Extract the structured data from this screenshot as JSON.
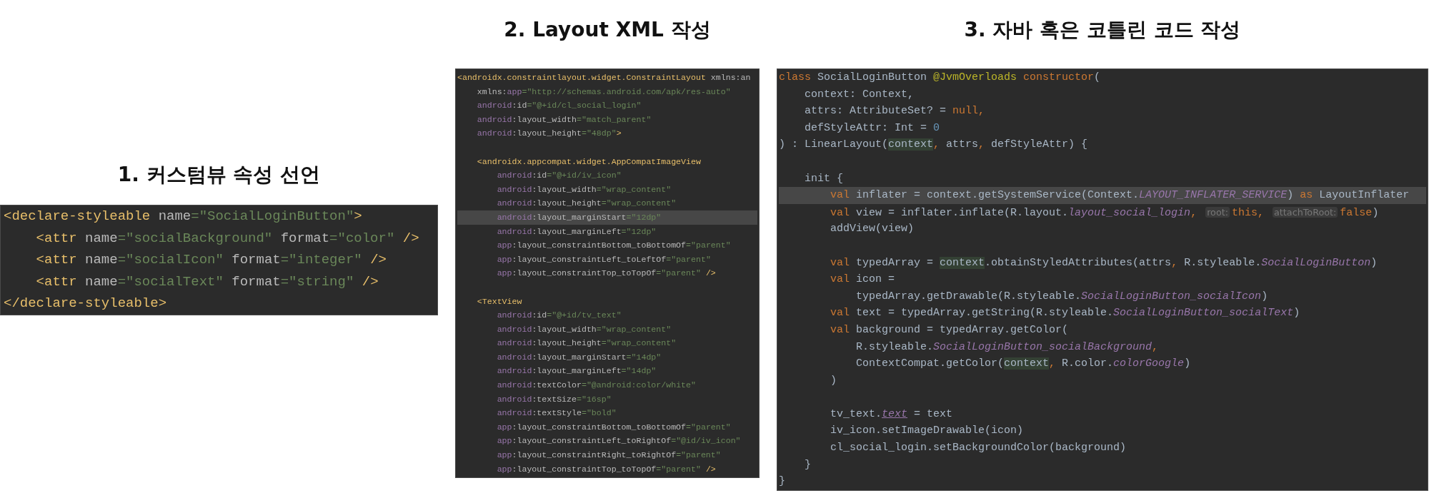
{
  "panels": [
    {
      "title": "1. 커스텀뷰 속성 선언",
      "lines": [
        {
          "kind": "code",
          "current": false,
          "tokens": [
            {
              "text": "<declare-styleable",
              "kind": "tag"
            },
            {
              "text": " name",
              "kind": "attr"
            },
            {
              "text": "=\"SocialLoginButton\"",
              "kind": "str"
            },
            {
              "text": ">",
              "kind": "tag"
            }
          ]
        },
        {
          "kind": "code",
          "current": false,
          "tokens": [
            {
              "text": "    <attr",
              "kind": "tag"
            },
            {
              "text": " name",
              "kind": "attr"
            },
            {
              "text": "=\"socialBackground\"",
              "kind": "str"
            },
            {
              "text": " format",
              "kind": "attr"
            },
            {
              "text": "=\"color\"",
              "kind": "str"
            },
            {
              "text": " />",
              "kind": "tag"
            }
          ]
        },
        {
          "kind": "code",
          "current": false,
          "tokens": [
            {
              "text": "    <attr",
              "kind": "tag"
            },
            {
              "text": " name",
              "kind": "attr"
            },
            {
              "text": "=\"socialIcon\"",
              "kind": "str"
            },
            {
              "text": " format",
              "kind": "attr"
            },
            {
              "text": "=\"integer\"",
              "kind": "str"
            },
            {
              "text": " />",
              "kind": "tag"
            }
          ]
        },
        {
          "kind": "code",
          "current": false,
          "tokens": [
            {
              "text": "    <attr",
              "kind": "tag"
            },
            {
              "text": " name",
              "kind": "attr"
            },
            {
              "text": "=\"socialText\"",
              "kind": "str"
            },
            {
              "text": " format",
              "kind": "attr"
            },
            {
              "text": "=\"string\"",
              "kind": "str"
            },
            {
              "text": " />",
              "kind": "tag"
            }
          ]
        },
        {
          "kind": "code",
          "current": false,
          "tokens": [
            {
              "text": "</declare-styleable>",
              "kind": "tag"
            }
          ]
        }
      ]
    },
    {
      "title": "2. Layout XML 작성",
      "lines": [
        {
          "kind": "code",
          "current": false,
          "tokens": [
            {
              "text": "<androidx.constraintlayout.widget.ConstraintLayout",
              "kind": "tag"
            },
            {
              "text": " xmlns:an",
              "kind": "attr"
            }
          ]
        },
        {
          "kind": "code",
          "current": false,
          "tokens": [
            {
              "text": "    xmlns:",
              "kind": "attr"
            },
            {
              "text": "app",
              "kind": "ns"
            },
            {
              "text": "=\"http://schemas.android.com/apk/res-auto\"",
              "kind": "str"
            }
          ]
        },
        {
          "kind": "code",
          "current": false,
          "tokens": [
            {
              "text": "    android",
              "kind": "ns"
            },
            {
              "text": ":id",
              "kind": "attr"
            },
            {
              "text": "=\"@+id/cl_social_login\"",
              "kind": "str"
            }
          ]
        },
        {
          "kind": "code",
          "current": false,
          "tokens": [
            {
              "text": "    android",
              "kind": "ns"
            },
            {
              "text": ":layout_width",
              "kind": "attr"
            },
            {
              "text": "=\"match_parent\"",
              "kind": "str"
            }
          ]
        },
        {
          "kind": "code",
          "current": false,
          "tokens": [
            {
              "text": "    android",
              "kind": "ns"
            },
            {
              "text": ":layout_height",
              "kind": "attr"
            },
            {
              "text": "=\"48dp\"",
              "kind": "str"
            },
            {
              "text": ">",
              "kind": "tag"
            }
          ]
        },
        {
          "kind": "blank",
          "current": false
        },
        {
          "kind": "code",
          "current": false,
          "tokens": [
            {
              "text": "    <androidx.appcompat.widget.AppCompatImageView",
              "kind": "tag"
            }
          ]
        },
        {
          "kind": "code",
          "current": false,
          "tokens": [
            {
              "text": "        android",
              "kind": "ns"
            },
            {
              "text": ":id",
              "kind": "attr"
            },
            {
              "text": "=\"@+id/iv_icon\"",
              "kind": "str"
            }
          ]
        },
        {
          "kind": "code",
          "current": false,
          "tokens": [
            {
              "text": "        android",
              "kind": "ns"
            },
            {
              "text": ":layout_width",
              "kind": "attr"
            },
            {
              "text": "=\"wrap_content\"",
              "kind": "str"
            }
          ]
        },
        {
          "kind": "code",
          "current": false,
          "tokens": [
            {
              "text": "        android",
              "kind": "ns"
            },
            {
              "text": ":layout_height",
              "kind": "attr"
            },
            {
              "text": "=\"wrap_content\"",
              "kind": "str"
            }
          ]
        },
        {
          "kind": "code",
          "current": true,
          "tokens": [
            {
              "text": "        android",
              "kind": "ns"
            },
            {
              "text": ":layout_marginStart",
              "kind": "attr"
            },
            {
              "text": "=\"12dp\"",
              "kind": "str"
            }
          ]
        },
        {
          "kind": "code",
          "current": false,
          "tokens": [
            {
              "text": "        android",
              "kind": "ns"
            },
            {
              "text": ":layout_marginLeft",
              "kind": "attr"
            },
            {
              "text": "=\"12dp\"",
              "kind": "str"
            }
          ]
        },
        {
          "kind": "code",
          "current": false,
          "tokens": [
            {
              "text": "        app",
              "kind": "ns"
            },
            {
              "text": ":layout_constraintBottom_toBottomOf",
              "kind": "attr"
            },
            {
              "text": "=\"parent\"",
              "kind": "str"
            }
          ]
        },
        {
          "kind": "code",
          "current": false,
          "tokens": [
            {
              "text": "        app",
              "kind": "ns"
            },
            {
              "text": ":layout_constraintLeft_toLeftOf",
              "kind": "attr"
            },
            {
              "text": "=\"parent\"",
              "kind": "str"
            }
          ]
        },
        {
          "kind": "code",
          "current": false,
          "tokens": [
            {
              "text": "        app",
              "kind": "ns"
            },
            {
              "text": ":layout_constraintTop_toTopOf",
              "kind": "attr"
            },
            {
              "text": "=\"parent\"",
              "kind": "str"
            },
            {
              "text": " />",
              "kind": "tag"
            }
          ]
        },
        {
          "kind": "blank",
          "current": false
        },
        {
          "kind": "code",
          "current": false,
          "tokens": [
            {
              "text": "    <TextView",
              "kind": "tag"
            }
          ]
        },
        {
          "kind": "code",
          "current": false,
          "tokens": [
            {
              "text": "        android",
              "kind": "ns"
            },
            {
              "text": ":id",
              "kind": "attr"
            },
            {
              "text": "=\"@+id/tv_text\"",
              "kind": "str"
            }
          ]
        },
        {
          "kind": "code",
          "current": false,
          "tokens": [
            {
              "text": "        android",
              "kind": "ns"
            },
            {
              "text": ":layout_width",
              "kind": "attr"
            },
            {
              "text": "=\"wrap_content\"",
              "kind": "str"
            }
          ]
        },
        {
          "kind": "code",
          "current": false,
          "tokens": [
            {
              "text": "        android",
              "kind": "ns"
            },
            {
              "text": ":layout_height",
              "kind": "attr"
            },
            {
              "text": "=\"wrap_content\"",
              "kind": "str"
            }
          ]
        },
        {
          "kind": "code",
          "current": false,
          "tokens": [
            {
              "text": "        android",
              "kind": "ns"
            },
            {
              "text": ":layout_marginStart",
              "kind": "attr"
            },
            {
              "text": "=\"14dp\"",
              "kind": "str"
            }
          ]
        },
        {
          "kind": "code",
          "current": false,
          "tokens": [
            {
              "text": "        android",
              "kind": "ns"
            },
            {
              "text": ":layout_marginLeft",
              "kind": "attr"
            },
            {
              "text": "=\"14dp\"",
              "kind": "str"
            }
          ]
        },
        {
          "kind": "code",
          "current": false,
          "tokens": [
            {
              "text": "        android",
              "kind": "ns"
            },
            {
              "text": ":textColor",
              "kind": "attr"
            },
            {
              "text": "=\"@android:color/white\"",
              "kind": "str"
            }
          ]
        },
        {
          "kind": "code",
          "current": false,
          "tokens": [
            {
              "text": "        android",
              "kind": "ns"
            },
            {
              "text": ":textSize",
              "kind": "attr"
            },
            {
              "text": "=\"16sp\"",
              "kind": "str"
            }
          ]
        },
        {
          "kind": "code",
          "current": false,
          "tokens": [
            {
              "text": "        android",
              "kind": "ns"
            },
            {
              "text": ":textStyle",
              "kind": "attr"
            },
            {
              "text": "=\"bold\"",
              "kind": "str"
            }
          ]
        },
        {
          "kind": "code",
          "current": false,
          "tokens": [
            {
              "text": "        app",
              "kind": "ns"
            },
            {
              "text": ":layout_constraintBottom_toBottomOf",
              "kind": "attr"
            },
            {
              "text": "=\"parent\"",
              "kind": "str"
            }
          ]
        },
        {
          "kind": "code",
          "current": false,
          "tokens": [
            {
              "text": "        app",
              "kind": "ns"
            },
            {
              "text": ":layout_constraintLeft_toRightOf",
              "kind": "attr"
            },
            {
              "text": "=\"@id/iv_icon\"",
              "kind": "str"
            }
          ]
        },
        {
          "kind": "code",
          "current": false,
          "tokens": [
            {
              "text": "        app",
              "kind": "ns"
            },
            {
              "text": ":layout_constraintRight_toRightOf",
              "kind": "attr"
            },
            {
              "text": "=\"parent\"",
              "kind": "str"
            }
          ]
        },
        {
          "kind": "code",
          "current": false,
          "tokens": [
            {
              "text": "        app",
              "kind": "ns"
            },
            {
              "text": ":layout_constraintTop_toTopOf",
              "kind": "attr"
            },
            {
              "text": "=\"parent\"",
              "kind": "str"
            },
            {
              "text": " />",
              "kind": "tag"
            }
          ]
        }
      ]
    },
    {
      "title": "3. 자바 혹은 코틀린 코드 작성",
      "lines": [
        {
          "kind": "code",
          "current": false,
          "tokens": [
            {
              "text": "class",
              "kind": "keyword"
            },
            {
              "text": " SocialLoginButton ",
              "kind": "plain"
            },
            {
              "text": "@JvmOverloads",
              "kind": "annotation"
            },
            {
              "text": " constructor",
              "kind": "keyword"
            },
            {
              "text": "(",
              "kind": "plain"
            }
          ]
        },
        {
          "kind": "code",
          "current": false,
          "tokens": [
            {
              "text": "    context",
              "kind": "declaration"
            },
            {
              "text": ": Context,",
              "kind": "plain"
            }
          ]
        },
        {
          "kind": "code",
          "current": false,
          "tokens": [
            {
              "text": "    attrs: AttributeSet? = ",
              "kind": "plain"
            },
            {
              "text": "null,",
              "kind": "keyword"
            }
          ]
        },
        {
          "kind": "code",
          "current": false,
          "tokens": [
            {
              "text": "    defStyleAttr: Int = ",
              "kind": "plain"
            },
            {
              "text": "0",
              "kind": "number"
            }
          ]
        },
        {
          "kind": "code",
          "current": false,
          "tokens": [
            {
              "text": ") : LinearLayout(",
              "kind": "plain"
            },
            {
              "text": "context",
              "kind": "usage"
            },
            {
              "text": ", ",
              "kind": "keyword"
            },
            {
              "text": "attrs",
              "kind": "plain"
            },
            {
              "text": ", ",
              "kind": "keyword"
            },
            {
              "text": "defStyleAttr) {",
              "kind": "plain"
            }
          ]
        },
        {
          "kind": "blank",
          "current": false
        },
        {
          "kind": "code",
          "current": false,
          "tokens": [
            {
              "text": "    init {",
              "kind": "plain"
            }
          ]
        },
        {
          "kind": "code",
          "current": true,
          "tokens": [
            {
              "text": "        val",
              "kind": "keyword"
            },
            {
              "text": " inflater = context.getSystemService(Context.",
              "kind": "plain"
            },
            {
              "text": "LAYOUT_INFLATER_SERVICE",
              "kind": "field"
            },
            {
              "text": ") ",
              "kind": "plain"
            },
            {
              "text": "as",
              "kind": "keyword"
            },
            {
              "text": " LayoutInflater",
              "kind": "plain"
            }
          ]
        },
        {
          "kind": "code",
          "current": false,
          "tokens": [
            {
              "text": "        val",
              "kind": "keyword"
            },
            {
              "text": " view = inflater.inflate(R.layout.",
              "kind": "plain"
            },
            {
              "text": "layout_social_login",
              "kind": "field"
            },
            {
              "text": ", ",
              "kind": "keyword"
            },
            {
              "text": "root:",
              "kind": "hint"
            },
            {
              "text": "this",
              "kind": "keyword"
            },
            {
              "text": ", ",
              "kind": "keyword"
            },
            {
              "text": "attachToRoot:",
              "kind": "hint"
            },
            {
              "text": "false",
              "kind": "keyword"
            },
            {
              "text": ")",
              "kind": "plain"
            }
          ]
        },
        {
          "kind": "code",
          "current": false,
          "tokens": [
            {
              "text": "        addView(view)",
              "kind": "plain"
            }
          ]
        },
        {
          "kind": "blank",
          "current": false
        },
        {
          "kind": "code",
          "current": false,
          "tokens": [
            {
              "text": "        val",
              "kind": "keyword"
            },
            {
              "text": " typedArray = ",
              "kind": "plain"
            },
            {
              "text": "context",
              "kind": "usage"
            },
            {
              "text": ".obtainStyledAttributes(attrs",
              "kind": "plain"
            },
            {
              "text": ", ",
              "kind": "keyword"
            },
            {
              "text": "R.styleable.",
              "kind": "plain"
            },
            {
              "text": "SocialLoginButton",
              "kind": "field"
            },
            {
              "text": ")",
              "kind": "plain"
            }
          ]
        },
        {
          "kind": "code",
          "current": false,
          "tokens": [
            {
              "text": "        val",
              "kind": "keyword"
            },
            {
              "text": " icon =",
              "kind": "plain"
            }
          ]
        },
        {
          "kind": "code",
          "current": false,
          "tokens": [
            {
              "text": "            typedArray.getDrawable(R.styleable.",
              "kind": "plain"
            },
            {
              "text": "SocialLoginButton_socialIcon",
              "kind": "field"
            },
            {
              "text": ")",
              "kind": "plain"
            }
          ]
        },
        {
          "kind": "code",
          "current": false,
          "tokens": [
            {
              "text": "        val",
              "kind": "keyword"
            },
            {
              "text": " text = typedArray.getString(R.styleable.",
              "kind": "plain"
            },
            {
              "text": "SocialLoginButton_socialText",
              "kind": "field"
            },
            {
              "text": ")",
              "kind": "plain"
            }
          ]
        },
        {
          "kind": "code",
          "current": false,
          "tokens": [
            {
              "text": "        val",
              "kind": "keyword"
            },
            {
              "text": " background = typedArray.getColor(",
              "kind": "plain"
            }
          ]
        },
        {
          "kind": "code",
          "current": false,
          "tokens": [
            {
              "text": "            R.styleable.",
              "kind": "plain"
            },
            {
              "text": "SocialLoginButton_socialBackground",
              "kind": "field"
            },
            {
              "text": ",",
              "kind": "keyword"
            }
          ]
        },
        {
          "kind": "code",
          "current": false,
          "tokens": [
            {
              "text": "            ContextCompat.getColor(",
              "kind": "plain"
            },
            {
              "text": "context",
              "kind": "usage"
            },
            {
              "text": ", ",
              "kind": "keyword"
            },
            {
              "text": "R.color.",
              "kind": "plain"
            },
            {
              "text": "colorGoogle",
              "kind": "field"
            },
            {
              "text": ")",
              "kind": "plain"
            }
          ]
        },
        {
          "kind": "code",
          "current": false,
          "tokens": [
            {
              "text": "        )",
              "kind": "plain"
            }
          ]
        },
        {
          "kind": "blank",
          "current": false
        },
        {
          "kind": "code",
          "current": false,
          "tokens": [
            {
              "text": "        tv_text.",
              "kind": "plain"
            },
            {
              "text": "text",
              "kind": "property"
            },
            {
              "text": " = text",
              "kind": "plain"
            }
          ]
        },
        {
          "kind": "code",
          "current": false,
          "tokens": [
            {
              "text": "        iv_icon.setImageDrawable(icon)",
              "kind": "plain"
            }
          ]
        },
        {
          "kind": "code",
          "current": false,
          "tokens": [
            {
              "text": "        cl_social_login.setBackgroundColor(background)",
              "kind": "plain"
            }
          ]
        },
        {
          "kind": "code",
          "current": false,
          "tokens": [
            {
              "text": "    }",
              "kind": "plain"
            }
          ]
        },
        {
          "kind": "code",
          "current": false,
          "tokens": [
            {
              "text": "}",
              "kind": "plain"
            }
          ]
        }
      ]
    }
  ]
}
